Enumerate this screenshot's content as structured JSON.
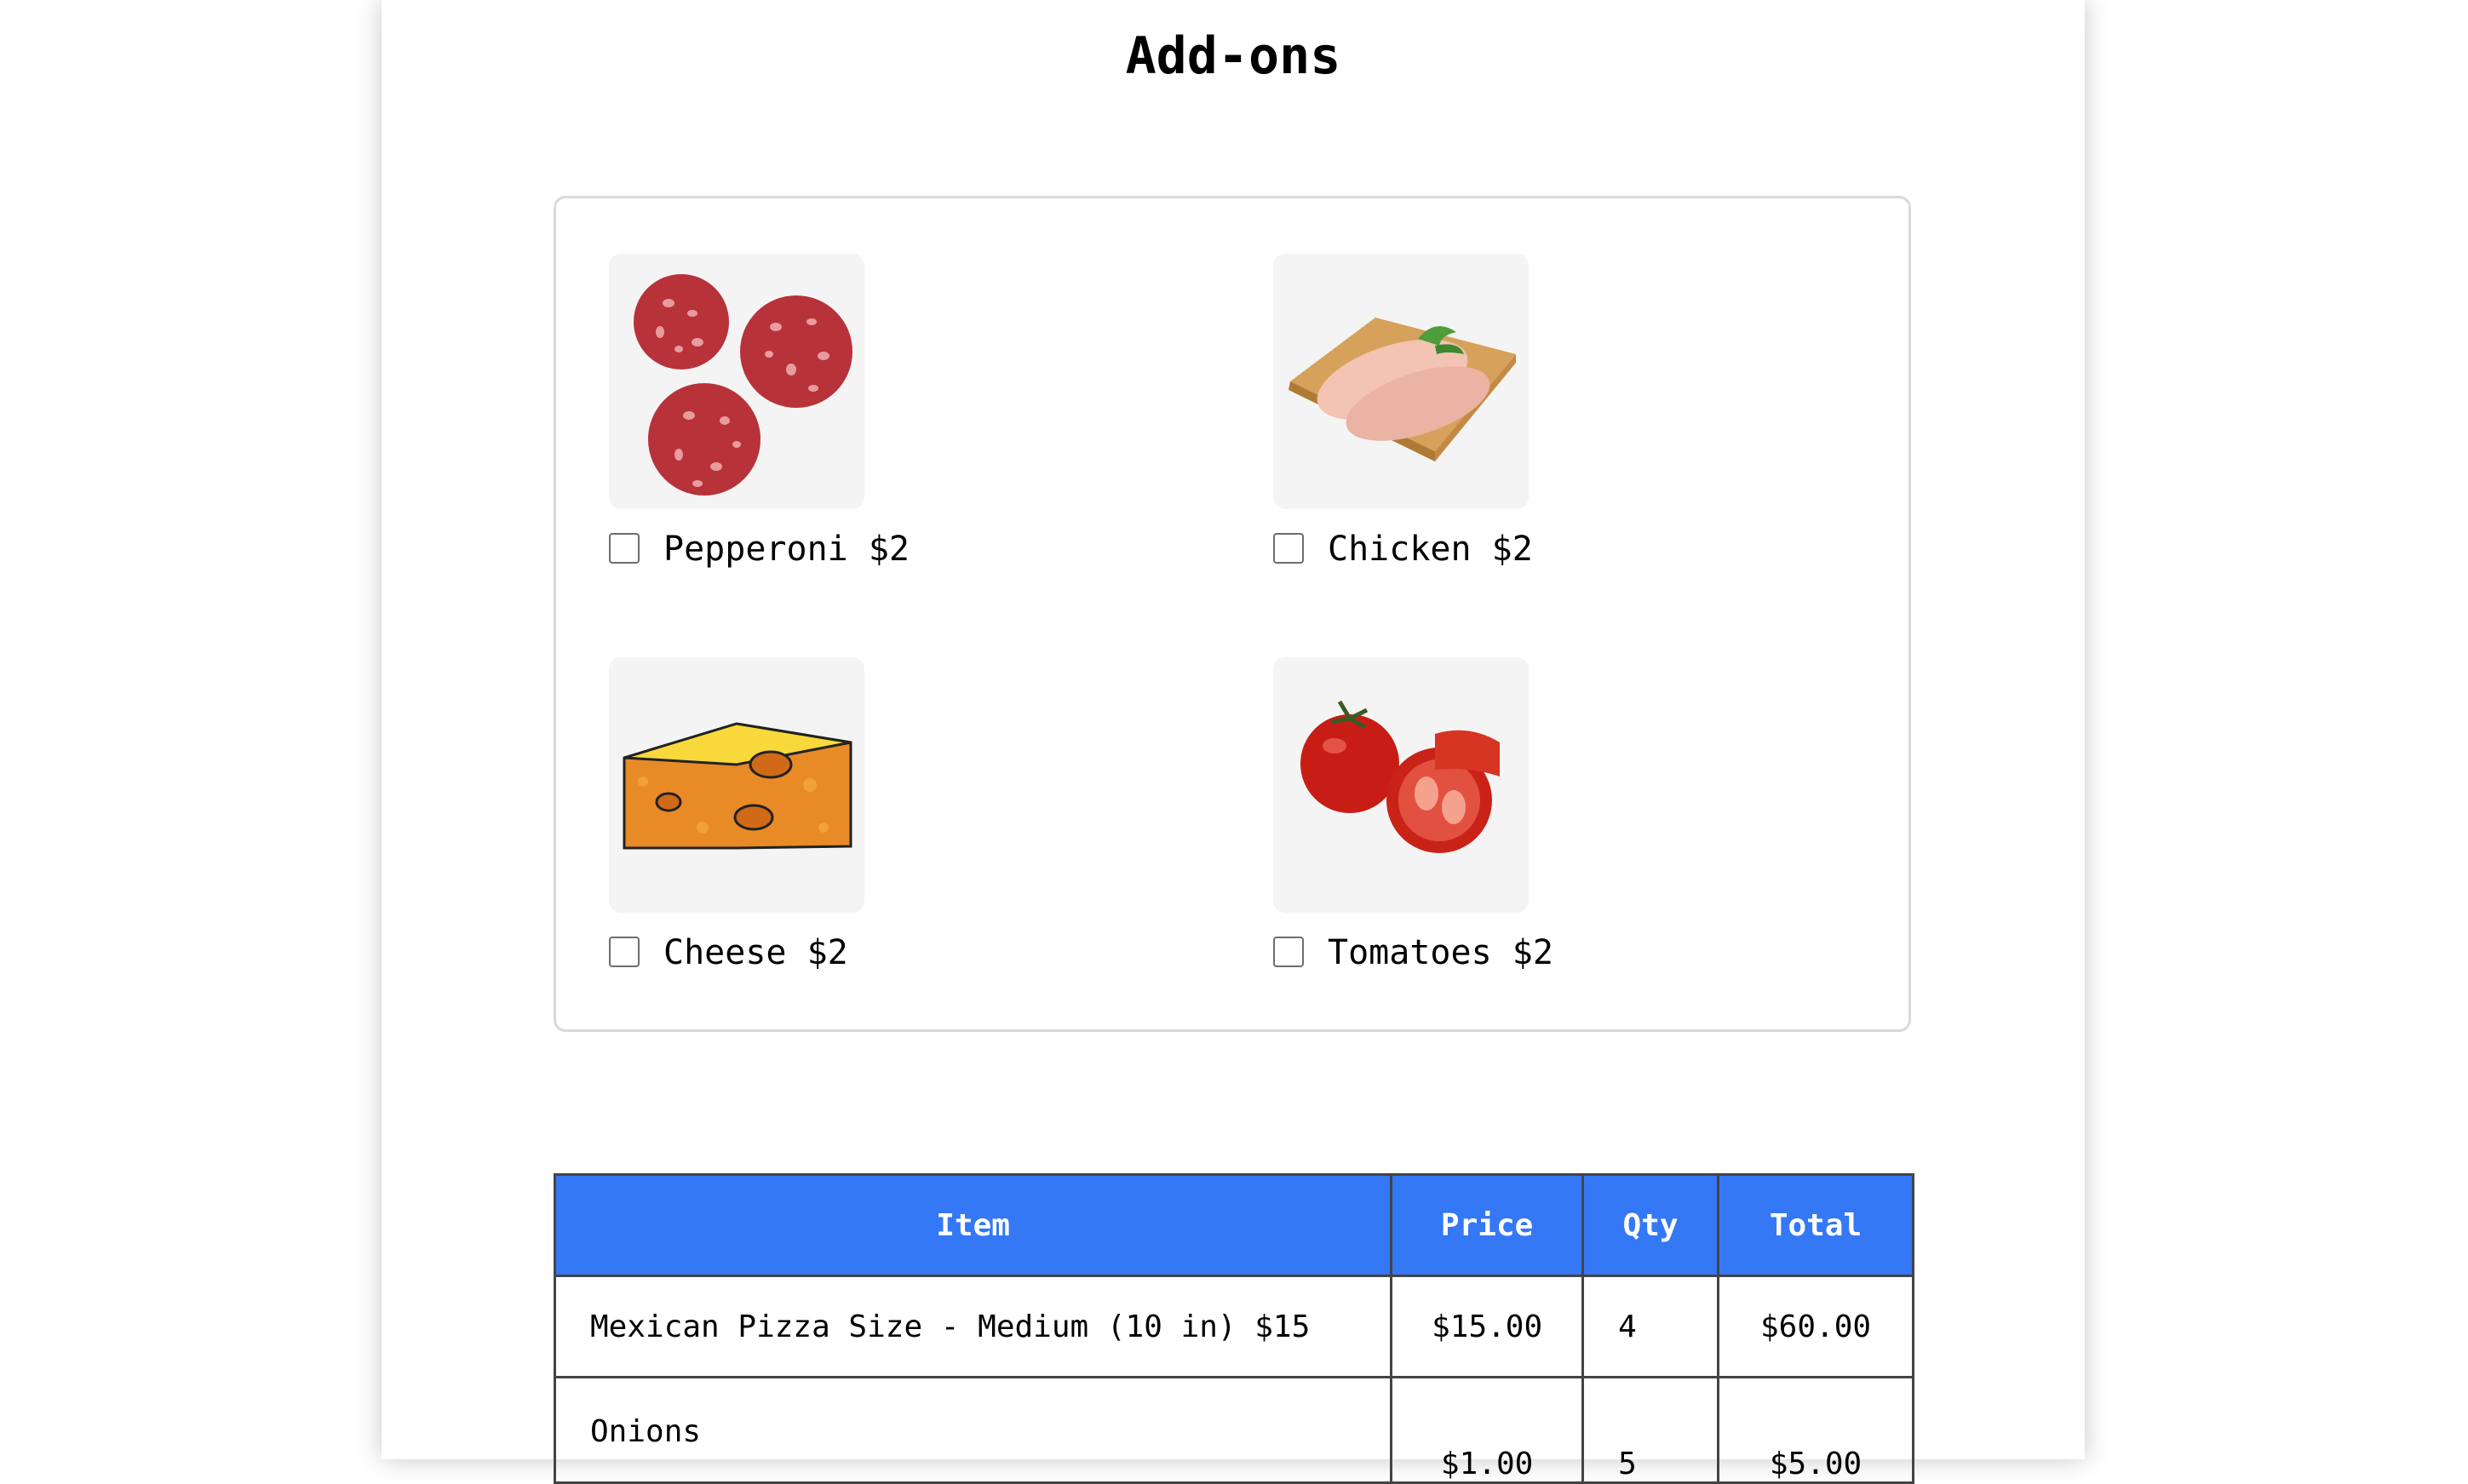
{
  "page": {
    "title": "Add-ons"
  },
  "addons": [
    {
      "label": "Pepperoni $2",
      "icon": "pepperoni-image",
      "checked": false
    },
    {
      "label": "Chicken $2",
      "icon": "chicken-image",
      "checked": false
    },
    {
      "label": "Cheese $2",
      "icon": "cheese-image",
      "checked": false
    },
    {
      "label": "Tomatoes $2",
      "icon": "tomatoes-image",
      "checked": false
    }
  ],
  "order_table": {
    "headers": [
      "Item",
      "Price",
      "Qty",
      "Total"
    ],
    "header_color": "#3478f6",
    "rows": [
      {
        "item": "Mexican Pizza Size - Medium (10 in) $15",
        "price": "$15.00",
        "qty": "4",
        "total": "$60.00"
      },
      {
        "item": "Onions",
        "price": "$1.00",
        "qty": "5",
        "total": "$5.00"
      }
    ]
  }
}
